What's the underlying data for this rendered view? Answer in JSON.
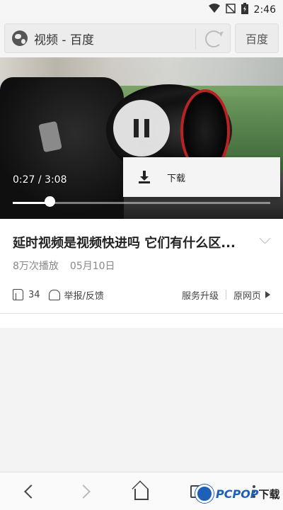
{
  "status_bar": {
    "time": "2:46",
    "icons": [
      "wifi-icon",
      "no-sim-icon",
      "battery-charging-icon"
    ]
  },
  "address_bar": {
    "title": "视频 - 百度",
    "search_label": "百度"
  },
  "video": {
    "current_time": "0:27",
    "duration": "3:08",
    "time_display": "0:27 / 3:08",
    "progress": 0.1436,
    "state": "playing"
  },
  "download_menu": {
    "label": "下载"
  },
  "info": {
    "title": "延时视频是视频快进吗 它们有什么区...",
    "views": "8万次播放",
    "date": "05月10日",
    "likes": "34",
    "report_label": "举报/反馈",
    "upgrade_label": "服务升级",
    "source_label": "原网页"
  },
  "bottom_nav": {
    "items": [
      "back-icon",
      "forward-icon",
      "home-icon",
      "tabs-icon",
      "more-icon"
    ]
  },
  "watermark": {
    "text": "PCPOP",
    "suffix": "下载"
  },
  "colors": {
    "accent": "#1e5fb8",
    "title_text": "#222222",
    "meta_text": "#888888"
  }
}
